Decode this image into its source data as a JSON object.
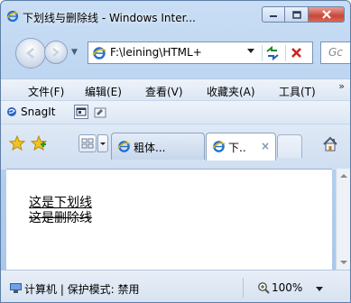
{
  "window": {
    "title": "下划线与删除线 - Windows Inter...",
    "minimize": "minimize",
    "maximize": "maximize",
    "close": "close"
  },
  "nav": {
    "address": "F:\\leining\\HTML+",
    "search_placeholder": "Gc"
  },
  "menu": {
    "items": [
      "文件(F)",
      "编辑(E)",
      "查看(V)",
      "收藏夹(A)",
      "工具(T)"
    ],
    "more": "»"
  },
  "snagit": {
    "label": "SnagIt"
  },
  "tabs": {
    "items": [
      {
        "label": "粗体...",
        "active": false
      },
      {
        "label": "下..",
        "active": true,
        "close": "×"
      }
    ]
  },
  "content": {
    "underline_text": "这是下划线",
    "strike_text": "这是删除线"
  },
  "status": {
    "zone": "计算机 | 保护模式: 禁用",
    "zoom": "100%"
  }
}
